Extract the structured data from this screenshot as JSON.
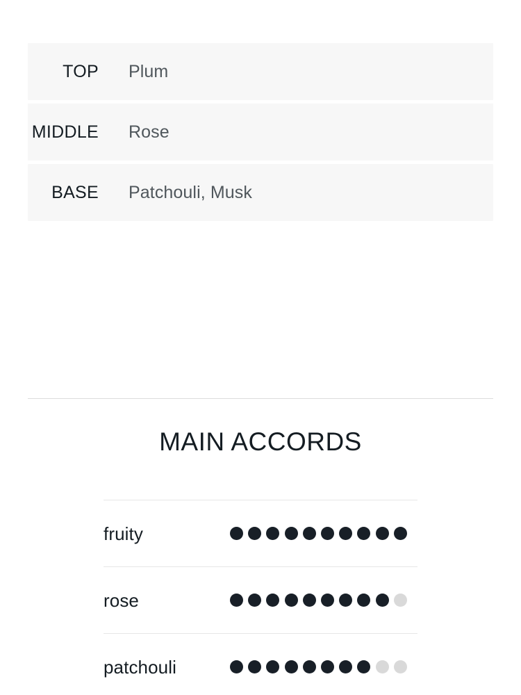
{
  "notes_pyramid": {
    "rows": [
      {
        "label": "TOP",
        "value": "Plum"
      },
      {
        "label": "MIDDLE",
        "value": "Rose"
      },
      {
        "label": "BASE",
        "value": "Patchouli, Musk"
      }
    ]
  },
  "main_accords": {
    "title": "MAIN ACCORDS",
    "max_dots": 10,
    "items": [
      {
        "name": "fruity",
        "filled": 10
      },
      {
        "name": "rose",
        "filled": 9
      },
      {
        "name": "patchouli",
        "filled": 8
      }
    ]
  },
  "colors": {
    "row_background": "#f7f7f7",
    "text_primary": "#141c22",
    "text_secondary": "#50575c",
    "dot_filled": "#181f27",
    "dot_empty": "#d9d9d9",
    "rule": "#dcdcdc"
  },
  "chart_data": {
    "type": "bar",
    "title": "MAIN ACCORDS",
    "categories": [
      "fruity",
      "rose",
      "patchouli"
    ],
    "values": [
      10,
      9,
      8
    ],
    "xlabel": "",
    "ylabel": "",
    "ylim": [
      0,
      10
    ],
    "notes": "Dot-rating scale, 10 dots maximum per accord; filled dots indicate accord strength."
  }
}
